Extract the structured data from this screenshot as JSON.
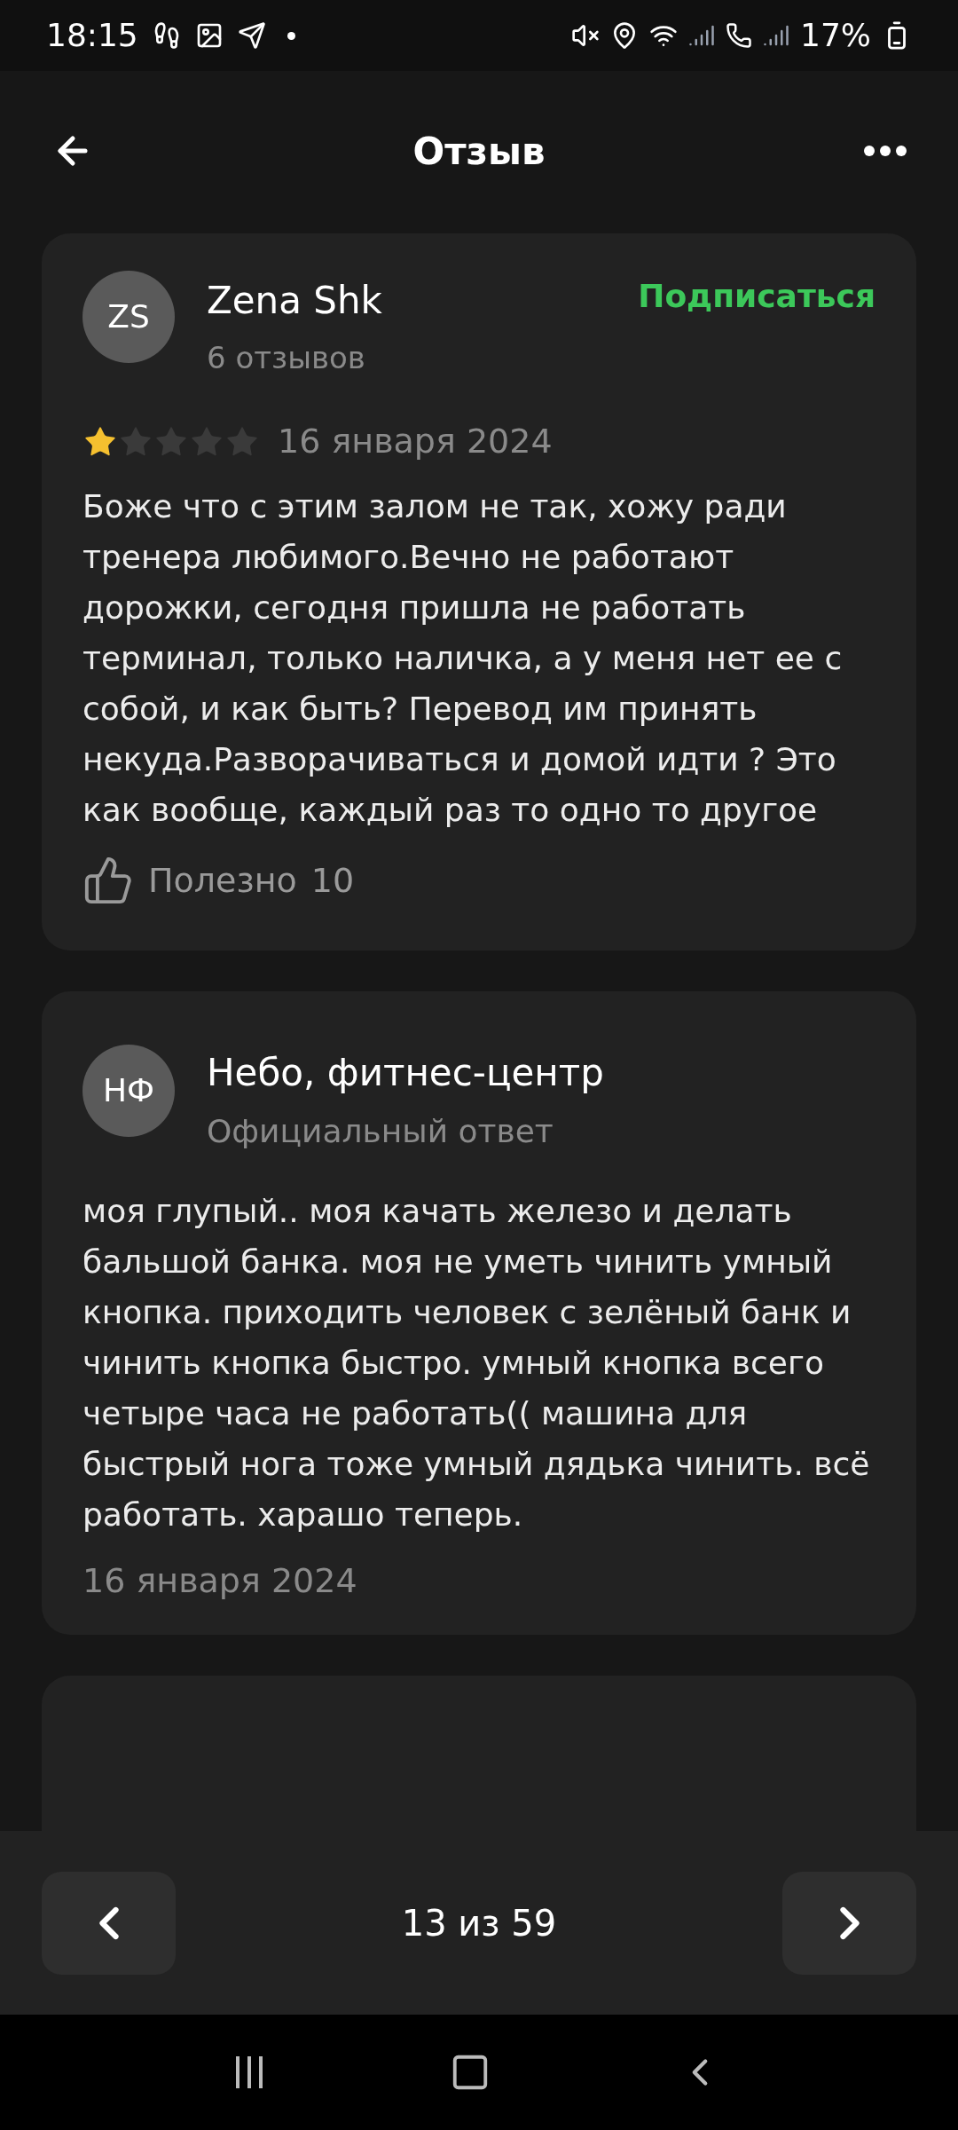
{
  "status_bar": {
    "time": "18:15",
    "battery": "17%"
  },
  "header": {
    "title": "Отзыв"
  },
  "review": {
    "avatar": "ZS",
    "author": "Zena Shk",
    "reviews_count": "6 отзывов",
    "follow": "Подписаться",
    "stars": 1,
    "date": "16 января 2024",
    "text": "Боже что с этим залом не так, хожу ради тренера любимого.Вечно не работают дорожки, сегодня пришла не работать терминал, только наличка, а у меня нет ее с собой, и как быть? Перевод им принять некуда.Разворачиваться и домой идти ? Это как вообще, каждый раз то одно то другое",
    "helpful_label": "Полезно",
    "helpful_count": "10"
  },
  "reply": {
    "avatar": "НФ",
    "author": "Небо, фитнес-центр",
    "subtitle": "Официальный ответ",
    "text": "моя глупый.. моя качать железо и делать бальшой банка. моя не уметь чинить умный кнопка. приходить человек с зелёный банк и чинить кнопка быстро. умный кнопка всего четыре часа не работать(( машина для быстрый нога тоже умный дядька чинить. всё работать. харашо теперь.",
    "date": "16 января 2024"
  },
  "pager": {
    "label": "13 из 59"
  }
}
